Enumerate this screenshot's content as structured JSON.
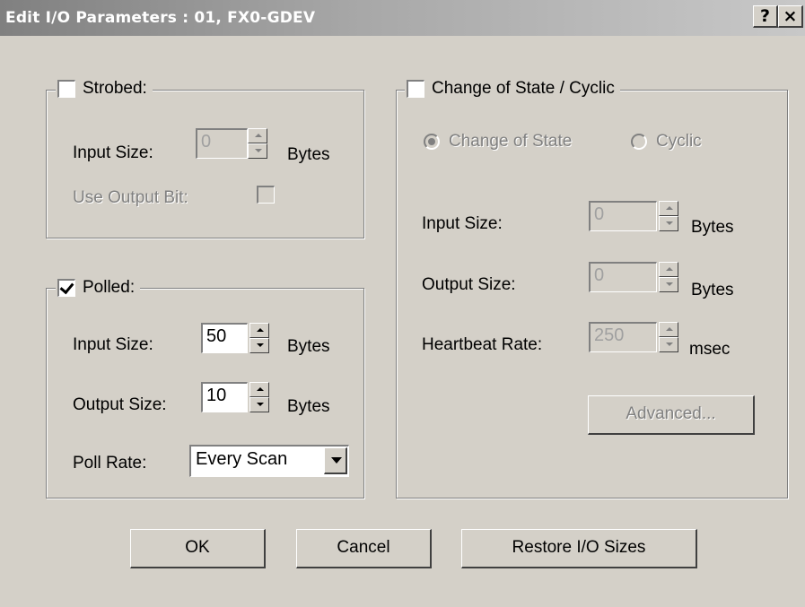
{
  "window": {
    "title": "Edit I/O Parameters : 01, FX0-GDEV",
    "help_label": "?",
    "close_label": "×"
  },
  "strobed": {
    "label": "Strobed:",
    "checked": false,
    "input_size_label": "Input Size:",
    "input_size_value": "0",
    "input_size_unit": "Bytes",
    "use_output_bit_label": "Use Output Bit:"
  },
  "polled": {
    "label": "Polled:",
    "checked": true,
    "input_size_label": "Input Size:",
    "input_size_value": "50",
    "input_size_unit": "Bytes",
    "output_size_label": "Output Size:",
    "output_size_value": "10",
    "output_size_unit": "Bytes",
    "poll_rate_label": "Poll Rate:",
    "poll_rate_value": "Every Scan"
  },
  "cos": {
    "label": "Change of State / Cyclic",
    "checked": false,
    "radio_change_of_state": "Change of State",
    "radio_cyclic": "Cyclic",
    "input_size_label": "Input Size:",
    "input_size_value": "0",
    "input_size_unit": "Bytes",
    "output_size_label": "Output Size:",
    "output_size_value": "0",
    "output_size_unit": "Bytes",
    "heartbeat_label": "Heartbeat Rate:",
    "heartbeat_value": "250",
    "heartbeat_unit": "msec",
    "advanced_label": "Advanced..."
  },
  "buttons": {
    "ok": "OK",
    "cancel": "Cancel",
    "restore": "Restore I/O Sizes"
  }
}
